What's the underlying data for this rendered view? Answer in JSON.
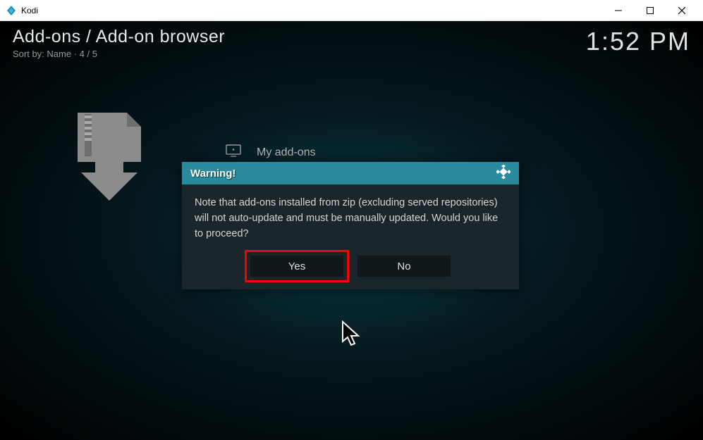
{
  "window": {
    "title": "Kodi"
  },
  "header": {
    "breadcrumb": "Add-ons / Add-on browser",
    "sort_label": "Sort by: Name  ·  4 / 5",
    "clock": "1:52 PM"
  },
  "background_item": {
    "label": "My add-ons"
  },
  "dialog": {
    "title": "Warning!",
    "message": "Note that add-ons installed from zip (excluding served repositories) will not auto-update and must be manually updated. Would you like to proceed?",
    "yes_label": "Yes",
    "no_label": "No"
  }
}
